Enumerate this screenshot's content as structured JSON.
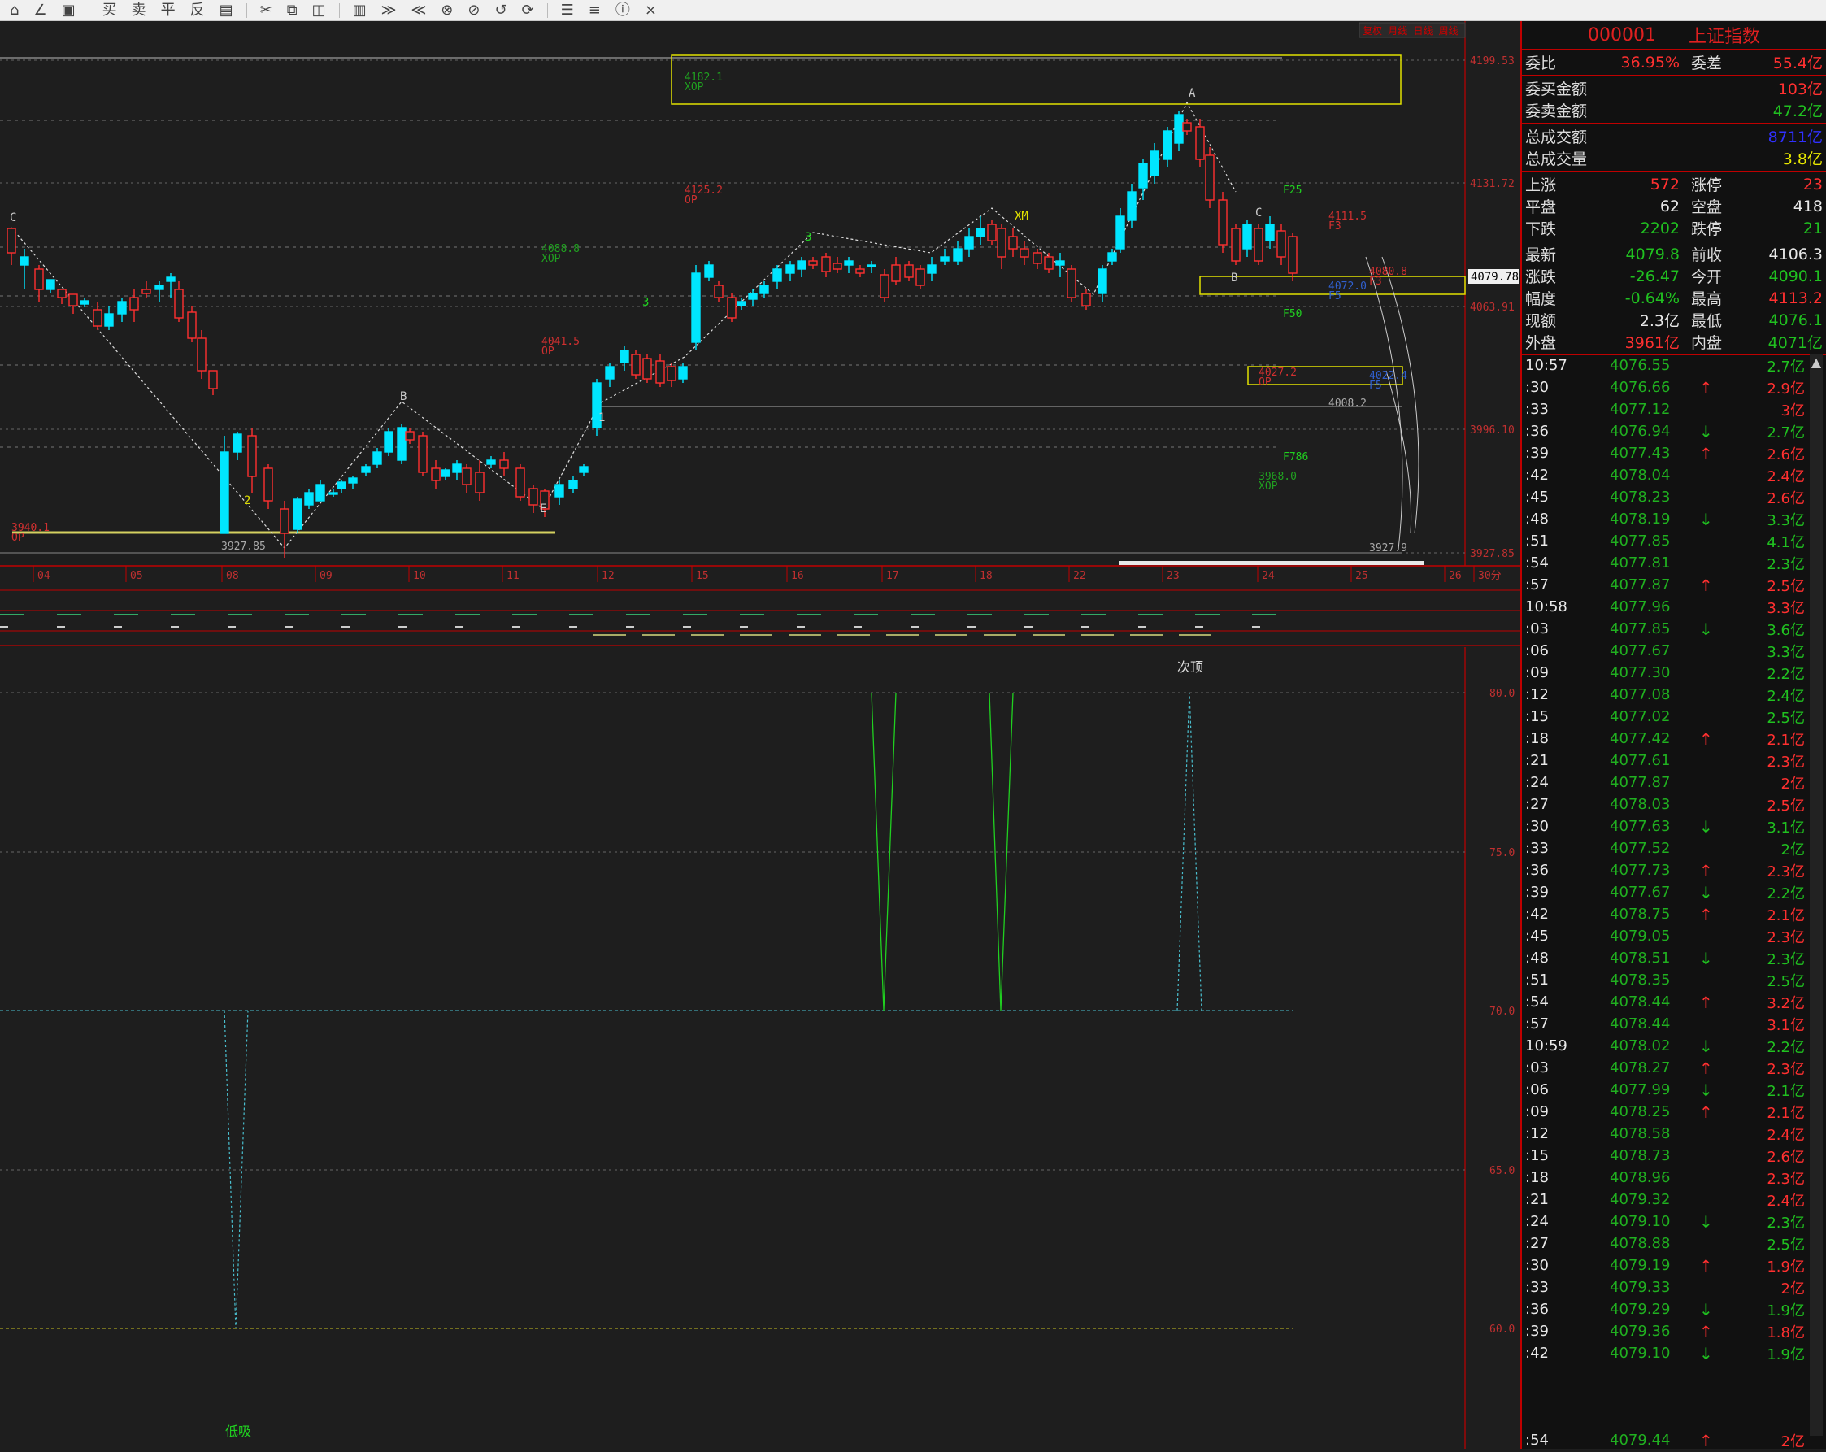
{
  "toolbar": {
    "items": [
      "⌂",
      "∠",
      "▣",
      "买",
      "卖",
      "平",
      "反",
      "▤",
      "✂",
      "⧉",
      "◫",
      "▥",
      "≫",
      "≪",
      "⊗",
      "⊘",
      "↺",
      "⟳",
      "☰",
      "≡",
      "ⓘ",
      "×"
    ]
  },
  "chart": {
    "price_axis": [
      "4199.53",
      "4131.72",
      "4063.91",
      "3996.10",
      "3927.85"
    ],
    "date_axis": [
      "04",
      "05",
      "08",
      "09",
      "10",
      "11",
      "12",
      "15",
      "16",
      "17",
      "18",
      "22",
      "23",
      "24",
      "25",
      "26",
      "30分"
    ],
    "current_price_tag": "4079.78",
    "top_right_tabs": [
      "复权",
      "月线",
      "日线",
      "周线"
    ],
    "annotations": {
      "box_top": "4182.1",
      "box_top_sub": "XOP",
      "l_4125": "4125.2",
      "l_4125_sub": "OP",
      "l_4088": "4088.8",
      "l_4088_sub": "XOP",
      "l_4041": "4041.5",
      "l_4041_sub": "OP",
      "l_3940": "3940.1",
      "l_3940_sub": "OP",
      "low_3927": "3927.85",
      "l_4111": "4111.5",
      "l_4111_sub": "F3",
      "l_4080": "4080.8",
      "l_4080_sub": "F3",
      "l_4072": "4072.0",
      "l_4072_sub": "F5",
      "l_4027": "4027.2",
      "l_4027_sub": "OP",
      "l_4022": "4022.4",
      "l_4022_sub": "F5",
      "l_4008": "4008.2",
      "l_3968": "3968.0",
      "l_3968_sub": "XOP",
      "l_3927_9": "3927.9",
      "f25": "F25",
      "f50": "F50",
      "f786": "F786",
      "wave_labels": [
        "C",
        "B",
        "A",
        "3",
        "1",
        "2",
        "XM",
        "C",
        "B",
        "3",
        "E"
      ]
    },
    "indicator_axis": [
      "80.0",
      "75.0",
      "70.0",
      "65.0",
      "60.0"
    ],
    "indicator_labels": {
      "top": "次顶",
      "low": "低吸"
    }
  },
  "quote": {
    "code": "000001",
    "name": "上证指数",
    "rows_block1": [
      {
        "l1": "委比",
        "v1": "36.95%",
        "l2": "委差",
        "v2": "55.4亿",
        "c1": "red",
        "c2": "red"
      }
    ],
    "rows_block2": [
      {
        "label": "委买金额",
        "value": "103亿",
        "color": "red"
      },
      {
        "label": "委卖金额",
        "value": "47.2亿",
        "color": "green"
      }
    ],
    "rows_block3": [
      {
        "label": "总成交额",
        "value": "8711亿",
        "color": "blue"
      },
      {
        "label": "总成交量",
        "value": "3.8亿",
        "color": "yellow"
      }
    ],
    "rows_block4": [
      {
        "l1": "上涨",
        "v1": "572",
        "l2": "涨停",
        "v2": "23",
        "c1": "red",
        "c2": "red"
      },
      {
        "l1": "平盘",
        "v1": "62",
        "l2": "空盘",
        "v2": "418",
        "c1": "white",
        "c2": "white"
      },
      {
        "l1": "下跌",
        "v1": "2202",
        "l2": "跌停",
        "v2": "21",
        "c1": "green",
        "c2": "green"
      }
    ],
    "rows_block5": [
      {
        "l1": "最新",
        "v1": "4079.8",
        "l2": "前收",
        "v2": "4106.3",
        "c1": "green",
        "c2": "white"
      },
      {
        "l1": "涨跌",
        "v1": "-26.47",
        "l2": "今开",
        "v2": "4090.1",
        "c1": "green",
        "c2": "green"
      },
      {
        "l1": "幅度",
        "v1": "-0.64%",
        "l2": "最高",
        "v2": "4113.2",
        "c1": "green",
        "c2": "red"
      },
      {
        "l1": "现额",
        "v1": "2.3亿",
        "l2": "最低",
        "v2": "4076.1",
        "c1": "white",
        "c2": "green"
      },
      {
        "l1": "外盘",
        "v1": "3961亿",
        "l2": "内盘",
        "v2": "4071亿",
        "c1": "red",
        "c2": "green"
      }
    ],
    "ticks": [
      {
        "t": "10:57",
        "p": "4076.55",
        "a": "",
        "v": "2.7亿",
        "vc": "green"
      },
      {
        "t": ":30",
        "p": "4076.66",
        "a": "↑",
        "v": "2.9亿",
        "vc": "red"
      },
      {
        "t": ":33",
        "p": "4077.12",
        "a": "",
        "v": "3亿",
        "vc": "red"
      },
      {
        "t": ":36",
        "p": "4076.94",
        "a": "↓",
        "v": "2.7亿",
        "vc": "green"
      },
      {
        "t": ":39",
        "p": "4077.43",
        "a": "↑",
        "v": "2.6亿",
        "vc": "red"
      },
      {
        "t": ":42",
        "p": "4078.04",
        "a": "",
        "v": "2.4亿",
        "vc": "red"
      },
      {
        "t": ":45",
        "p": "4078.23",
        "a": "",
        "v": "2.6亿",
        "vc": "red"
      },
      {
        "t": ":48",
        "p": "4078.19",
        "a": "↓",
        "v": "3.3亿",
        "vc": "green"
      },
      {
        "t": ":51",
        "p": "4077.85",
        "a": "",
        "v": "4.1亿",
        "vc": "green"
      },
      {
        "t": ":54",
        "p": "4077.81",
        "a": "",
        "v": "2.3亿",
        "vc": "green"
      },
      {
        "t": ":57",
        "p": "4077.87",
        "a": "↑",
        "v": "2.5亿",
        "vc": "red"
      },
      {
        "t": "10:58",
        "p": "4077.96",
        "a": "",
        "v": "3.3亿",
        "vc": "red"
      },
      {
        "t": ":03",
        "p": "4077.85",
        "a": "↓",
        "v": "3.6亿",
        "vc": "green"
      },
      {
        "t": ":06",
        "p": "4077.67",
        "a": "",
        "v": "3.3亿",
        "vc": "green"
      },
      {
        "t": ":09",
        "p": "4077.30",
        "a": "",
        "v": "2.2亿",
        "vc": "green"
      },
      {
        "t": ":12",
        "p": "4077.08",
        "a": "",
        "v": "2.4亿",
        "vc": "green"
      },
      {
        "t": ":15",
        "p": "4077.02",
        "a": "",
        "v": "2.5亿",
        "vc": "green"
      },
      {
        "t": ":18",
        "p": "4077.42",
        "a": "↑",
        "v": "2.1亿",
        "vc": "red"
      },
      {
        "t": ":21",
        "p": "4077.61",
        "a": "",
        "v": "2.3亿",
        "vc": "red"
      },
      {
        "t": ":24",
        "p": "4077.87",
        "a": "",
        "v": "2亿",
        "vc": "red"
      },
      {
        "t": ":27",
        "p": "4078.03",
        "a": "",
        "v": "2.5亿",
        "vc": "red"
      },
      {
        "t": ":30",
        "p": "4077.63",
        "a": "↓",
        "v": "3.1亿",
        "vc": "green"
      },
      {
        "t": ":33",
        "p": "4077.52",
        "a": "",
        "v": "2亿",
        "vc": "green"
      },
      {
        "t": ":36",
        "p": "4077.73",
        "a": "↑",
        "v": "2.3亿",
        "vc": "red"
      },
      {
        "t": ":39",
        "p": "4077.67",
        "a": "↓",
        "v": "2.2亿",
        "vc": "green"
      },
      {
        "t": ":42",
        "p": "4078.75",
        "a": "↑",
        "v": "2.1亿",
        "vc": "red"
      },
      {
        "t": ":45",
        "p": "4079.05",
        "a": "",
        "v": "2.3亿",
        "vc": "red"
      },
      {
        "t": ":48",
        "p": "4078.51",
        "a": "↓",
        "v": "2.3亿",
        "vc": "green"
      },
      {
        "t": ":51",
        "p": "4078.35",
        "a": "",
        "v": "2.5亿",
        "vc": "green"
      },
      {
        "t": ":54",
        "p": "4078.44",
        "a": "↑",
        "v": "3.2亿",
        "vc": "red"
      },
      {
        "t": ":57",
        "p": "4078.44",
        "a": "",
        "v": "3.1亿",
        "vc": "red"
      },
      {
        "t": "10:59",
        "p": "4078.02",
        "a": "↓",
        "v": "2.2亿",
        "vc": "green"
      },
      {
        "t": ":03",
        "p": "4078.27",
        "a": "↑",
        "v": "2.3亿",
        "vc": "red"
      },
      {
        "t": ":06",
        "p": "4077.99",
        "a": "↓",
        "v": "2.1亿",
        "vc": "green"
      },
      {
        "t": ":09",
        "p": "4078.25",
        "a": "↑",
        "v": "2.1亿",
        "vc": "red"
      },
      {
        "t": ":12",
        "p": "4078.58",
        "a": "",
        "v": "2.4亿",
        "vc": "red"
      },
      {
        "t": ":15",
        "p": "4078.73",
        "a": "",
        "v": "2.6亿",
        "vc": "red"
      },
      {
        "t": ":18",
        "p": "4078.96",
        "a": "",
        "v": "2.3亿",
        "vc": "red"
      },
      {
        "t": ":21",
        "p": "4079.32",
        "a": "",
        "v": "2.4亿",
        "vc": "red"
      },
      {
        "t": ":24",
        "p": "4079.10",
        "a": "↓",
        "v": "2.3亿",
        "vc": "green"
      },
      {
        "t": ":27",
        "p": "4078.88",
        "a": "",
        "v": "2.5亿",
        "vc": "green"
      },
      {
        "t": ":30",
        "p": "4079.19",
        "a": "↑",
        "v": "1.9亿",
        "vc": "red"
      },
      {
        "t": ":33",
        "p": "4079.33",
        "a": "",
        "v": "2亿",
        "vc": "red"
      },
      {
        "t": ":36",
        "p": "4079.29",
        "a": "↓",
        "v": "1.9亿",
        "vc": "green"
      },
      {
        "t": ":39",
        "p": "4079.36",
        "a": "↑",
        "v": "1.8亿",
        "vc": "red"
      },
      {
        "t": ":42",
        "p": "4079.10",
        "a": "↓",
        "v": "1.9亿",
        "vc": "green"
      }
    ],
    "last_tick": {
      "t": ":54",
      "p": "4079.44",
      "a": "↑",
      "v": "2亿",
      "vc": "red"
    }
  },
  "colors": {
    "up": "#ff3030",
    "down": "#00e5ff",
    "bg": "#1e1e1e",
    "axis": "#c00000",
    "yellow": "#e0e000"
  }
}
